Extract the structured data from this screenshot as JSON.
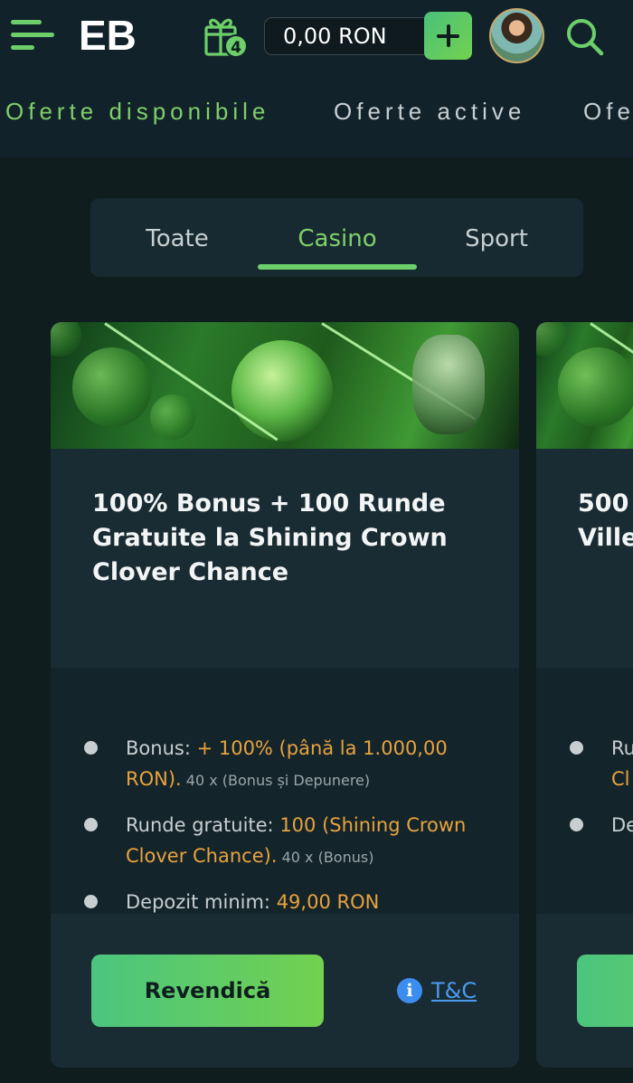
{
  "header": {
    "logo_text": "EB",
    "gift_count": "4",
    "balance": "0,00 RON",
    "menu_icon": "hamburger-menu-icon",
    "gift_icon": "gift-icon",
    "deposit_icon": "plus-icon",
    "search_icon": "search-icon"
  },
  "offer_tabs": [
    {
      "label": "Oferte disponibile",
      "active": true
    },
    {
      "label": "Oferte active",
      "active": false
    },
    {
      "label": "Ofe",
      "active": false
    }
  ],
  "categories": [
    {
      "label": "Toate",
      "active": false
    },
    {
      "label": "Casino",
      "active": true
    },
    {
      "label": "Sport",
      "active": false
    }
  ],
  "cards": [
    {
      "title": "100% Bonus + 100 Runde Gratuite la Shining Crown Clover Chance",
      "details": [
        {
          "label": "Bonus: ",
          "highlight": "+ 100% (până la 1.000,00 RON).",
          "note": " 40 x (Bonus și Depunere)"
        },
        {
          "label": "Runde gratuite: ",
          "highlight": "100 (Shining Crown Clover Chance).",
          "note": " 40 x (Bonus)"
        },
        {
          "label": "Depozit minim: ",
          "highlight": "49,00 RON",
          "note": ""
        }
      ],
      "claim_label": "Revendică",
      "tc_label": "T&C"
    },
    {
      "title_line1": "500",
      "title_line2": "Ville",
      "detail1": "Ru",
      "detail1b": "Cl",
      "detail2": "De"
    }
  ],
  "colors": {
    "accent": "#6ccf6a",
    "highlight": "#e8a33e",
    "link": "#4a9bf0",
    "background": "#0f1d1f"
  }
}
